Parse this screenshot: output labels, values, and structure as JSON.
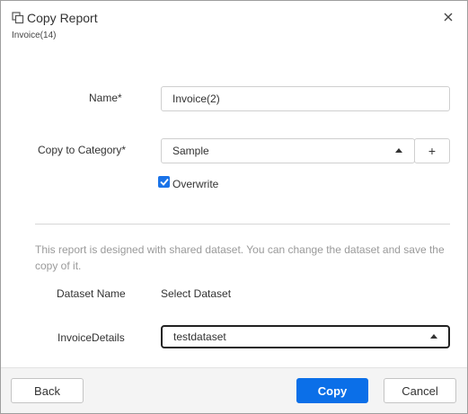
{
  "dialog": {
    "title": "Copy Report",
    "subtitle": "Invoice(14)",
    "icons": {
      "title_icon": "copy-icon",
      "close_icon": "close-icon"
    }
  },
  "form": {
    "name_label": "Name",
    "required_mark": "*",
    "name_value": "Invoice(2)",
    "category_label": "Copy to Category",
    "category_value": "Sample",
    "add_category_label": "+",
    "overwrite_label": "Overwrite",
    "overwrite_checked": true
  },
  "dataset": {
    "info_text": "This report is designed with shared dataset. You can change the dataset and save the copy of it.",
    "col_name_header": "Dataset Name",
    "col_select_header": "Select Dataset",
    "rows": [
      {
        "name": "InvoiceDetails",
        "selected": "testdataset"
      }
    ]
  },
  "footer": {
    "back_label": "Back",
    "copy_label": "Copy",
    "cancel_label": "Cancel"
  },
  "colors": {
    "primary": "#0b6fe8",
    "checkbox": "#1a73e8",
    "muted_text": "#9a9a9a"
  }
}
